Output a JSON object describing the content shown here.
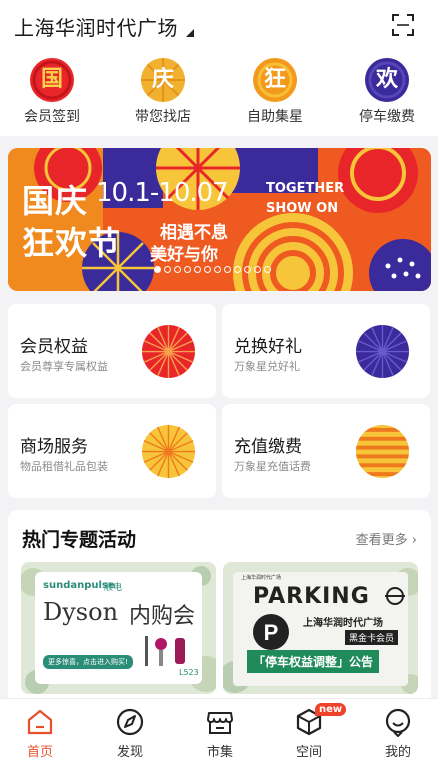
{
  "header": {
    "mall_name": "上海华润时代广场"
  },
  "quick_actions": [
    {
      "char": "国",
      "label": "会员签到",
      "icon": "national-day-icon",
      "color": "#e8262a",
      "text_color": "#f7d24a"
    },
    {
      "char": "庆",
      "label": "带您找店",
      "icon": "find-store-icon",
      "color": "#f1b12f",
      "text_color": "#ffffff"
    },
    {
      "char": "狂",
      "label": "自助集星",
      "icon": "collect-stars-icon",
      "color": "#f39a1c",
      "text_color": "#ffffff"
    },
    {
      "char": "欢",
      "label": "停车缴费",
      "icon": "parking-pay-icon",
      "color": "#3a2a9a",
      "text_color": "#ffffff"
    }
  ],
  "banner": {
    "title_line1": "国庆",
    "dates": "10.1-10.07",
    "title_line2": "狂欢节",
    "en_line1": "TOGETHER",
    "en_line2": "SHOW ON",
    "slogan1": "相遇不息",
    "slogan2": "美好与你",
    "slide_count": 12,
    "active_slide": 1
  },
  "services": [
    {
      "title": "会员权益",
      "subtitle": "会员尊享专属权益",
      "icon": "red-sunburst-icon"
    },
    {
      "title": "兑换好礼",
      "subtitle": "万象星兑好礼",
      "icon": "purple-sunburst-icon"
    },
    {
      "title": "商场服务",
      "subtitle": "物品租借礼品包装",
      "icon": "yellow-sunburst-icon"
    },
    {
      "title": "充值缴费",
      "subtitle": "万象星充值话费",
      "icon": "orange-stripes-icon"
    }
  ],
  "hot": {
    "title": "热门专题活动",
    "more": "查看更多",
    "promos": [
      {
        "brand": "sundanpulse",
        "brand_cn": "顺电",
        "headline_en": "Dyson",
        "headline_cn": "内购会",
        "button": "更多惊喜，点击进入购买!",
        "location": "L523"
      },
      {
        "logo": "上海华润时代广场",
        "title": "PARKING",
        "mall": "上海华润时代广场",
        "tier": "黑金卡会员",
        "notice": "「停车权益调整」公告"
      }
    ]
  },
  "tabbar": [
    {
      "label": "首页",
      "icon": "home-icon",
      "active": true
    },
    {
      "label": "发现",
      "icon": "compass-icon",
      "active": false
    },
    {
      "label": "市集",
      "icon": "store-icon",
      "active": false
    },
    {
      "label": "空间",
      "icon": "cube-icon",
      "active": false,
      "badge": "new"
    },
    {
      "label": "我的",
      "icon": "profile-icon",
      "active": false
    }
  ],
  "colors": {
    "accent": "#e8502c",
    "banner_orange": "#ef5a20",
    "banner_purple": "#3a2a9a",
    "banner_yellow": "#f6c53a"
  }
}
